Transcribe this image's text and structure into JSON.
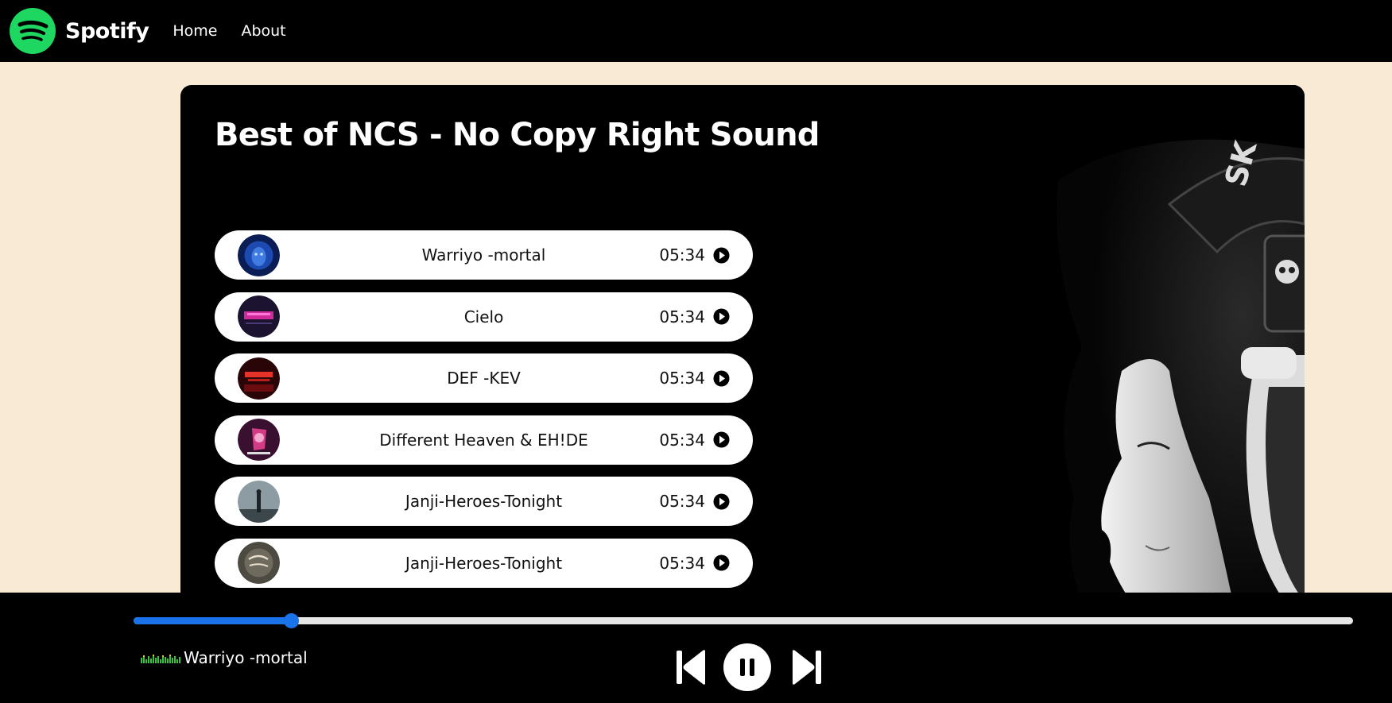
{
  "nav": {
    "brand": "Spotify",
    "logo_icon": "spotify-logo-icon",
    "links": [
      "Home",
      "About"
    ]
  },
  "main": {
    "title": "Best of NCS - No Copy Right Sound",
    "hero_image": "woman-with-headphones-photo"
  },
  "songs": [
    {
      "name": "Warriyo -mortal",
      "time": "05:34",
      "cover_color": "#1d3f8f"
    },
    {
      "name": "Cielo",
      "time": "05:34",
      "cover_color": "#2a1a3d"
    },
    {
      "name": "DEF -KEV",
      "time": "05:34",
      "cover_color": "#4a0c10"
    },
    {
      "name": "Different Heaven & EH!DE",
      "time": "05:34",
      "cover_color": "#7a2a5a"
    },
    {
      "name": "Janji-Heroes-Tonight",
      "time": "05:34",
      "cover_color": "#6c7a80"
    },
    {
      "name": "Janji-Heroes-Tonight",
      "time": "05:34",
      "cover_color": "#5a5a50"
    }
  ],
  "player": {
    "now_playing": "Warriyo -mortal",
    "progress_percent": 12.9,
    "progress_color": "#1a73e8",
    "eq_icon": "equalizer-gif-icon",
    "controls": [
      "previous-icon",
      "pause-icon",
      "next-icon"
    ]
  },
  "colors": {
    "page_bg": "#f9ead6",
    "brand_green": "#1ed760"
  }
}
